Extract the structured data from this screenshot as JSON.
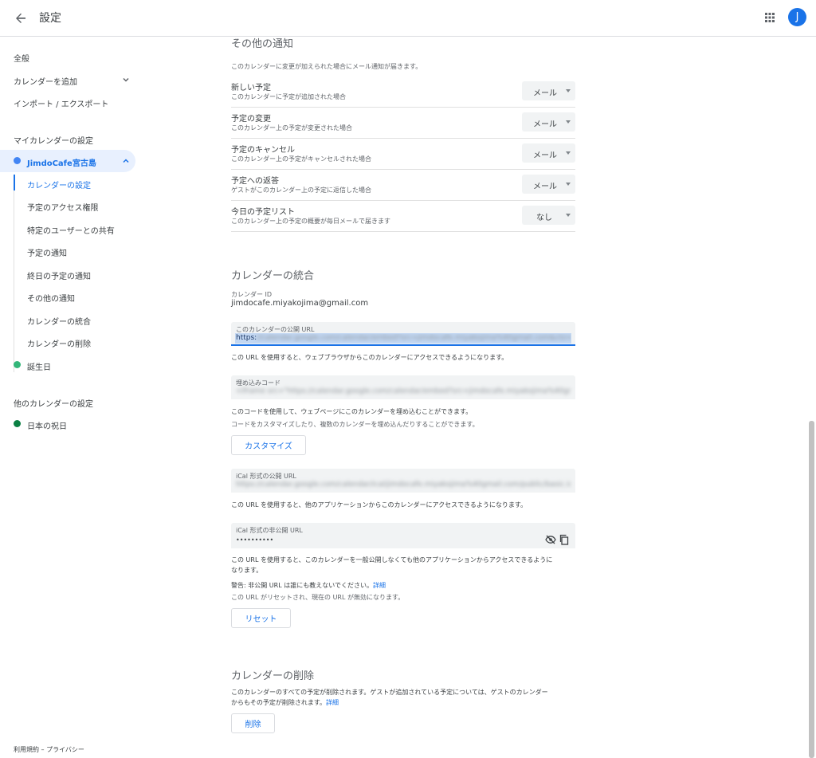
{
  "header": {
    "title": "設定",
    "avatar_letter": "J"
  },
  "sidebar": {
    "general": "全般",
    "add_calendar": "カレンダーを追加",
    "import_export": "インポート / エクスポート",
    "my_calendars_heading": "マイカレンダーの設定",
    "my_calendar": {
      "name": "JimdoCafe宮古島",
      "color": "#4285f4"
    },
    "sub_items": [
      "カレンダーの設定",
      "予定のアクセス権限",
      "特定のユーザーとの共有",
      "予定の通知",
      "終日の予定の通知",
      "その他の通知",
      "カレンダーの統合",
      "カレンダーの削除"
    ],
    "birthday": {
      "name": "誕生日",
      "color": "#33b679"
    },
    "other_calendars_heading": "他のカレンダーの設定",
    "holidays": {
      "name": "日本の祝日",
      "color": "#0b8043"
    }
  },
  "other_notifications": {
    "title": "その他の通知",
    "description": "このカレンダーに変更が加えられた場合にメール通知が届きます。",
    "rows": [
      {
        "title": "新しい予定",
        "desc": "このカレンダーに予定が追加された場合",
        "value": "メール"
      },
      {
        "title": "予定の変更",
        "desc": "このカレンダー上の予定が変更された場合",
        "value": "メール"
      },
      {
        "title": "予定のキャンセル",
        "desc": "このカレンダー上の予定がキャンセルされた場合",
        "value": "メール"
      },
      {
        "title": "予定への返答",
        "desc": "ゲストがこのカレンダー上の予定に返信した場合",
        "value": "メール"
      },
      {
        "title": "今日の予定リスト",
        "desc": "このカレンダー上の予定の概要が毎日メールで届きます",
        "value": "なし"
      }
    ]
  },
  "integration": {
    "title": "カレンダーの統合",
    "calendar_id_label": "カレンダー ID",
    "calendar_id": "jimdocafe.miyakojima@gmail.com",
    "public_url_label": "このカレンダーの公開 URL",
    "public_url_prefix": "https:",
    "public_url_rest": "//calendar.google.com/calendar/embed?src=jimdocafe.miyakojima%40gmail.com&ctz=Asia%2FTokyo",
    "public_url_note": "この URL を使用すると、ウェブブラウザからこのカレンダーにアクセスできるようになります。",
    "embed_label": "埋め込みコード",
    "embed_code": "<iframe src=\"https://calendar.google.com/calendar/embed?src=jimdocafe.miyakojima%40gmail.com\"",
    "embed_note_1": "このコードを使用して、ウェブページにこのカレンダーを埋め込むことができます。",
    "embed_note_2": "コードをカスタマイズしたり、複数のカレンダーを埋め込んだりすることができます。",
    "customize_button": "カスタマイズ",
    "ical_public_label": "iCal 形式の公開 URL",
    "ical_public_url": "https://calendar.google.com/calendar/ical/jimdocafe.miyakojima%40gmail.com/public/basic.ics",
    "ical_public_note": "この URL を使用すると、他のアプリケーションからこのカレンダーにアクセスできるようになります。",
    "ical_private_label": "iCal 形式の非公開 URL",
    "ical_private_value": "••••••••••",
    "ical_private_note_1": "この URL を使用すると、このカレンダーを一般公開しなくても他のアプリケーションからアクセスできるように",
    "ical_private_note_2": "なります。",
    "warning": "警告: 非公開 URL は誰にも教えないでください。",
    "warning_link": "詳細",
    "reset_note": "この URL がリセットされ、現在の URL が無効になります。",
    "reset_button": "リセット"
  },
  "delete_section": {
    "title": "カレンダーの削除",
    "desc_1": "このカレンダーのすべての予定が削除されます。ゲストが追加されている予定については、ゲストのカレンダー",
    "desc_2": "からもその予定が削除されます。",
    "link": "詳細",
    "button": "削除"
  },
  "footer": {
    "terms": "利用規約",
    "separator": " – ",
    "privacy": "プライバシー"
  }
}
